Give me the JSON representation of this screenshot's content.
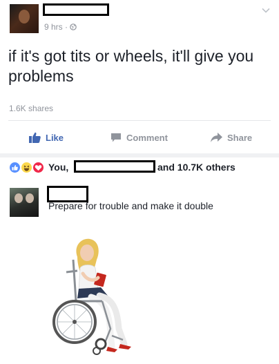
{
  "post": {
    "time": "9 hrs",
    "separator": "·",
    "text": "if it's got tits or wheels, it'll give you problems",
    "shares": "1.6K shares"
  },
  "actions": {
    "like": "Like",
    "comment": "Comment",
    "share": "Share"
  },
  "reactions": {
    "you": "You,",
    "others": "and 10.7K others"
  },
  "comment": {
    "text": "Prepare for trouble and make it double"
  },
  "colors": {
    "like_blue": "#4267b2",
    "muted_text": "#90949c",
    "text": "#1d2129"
  }
}
